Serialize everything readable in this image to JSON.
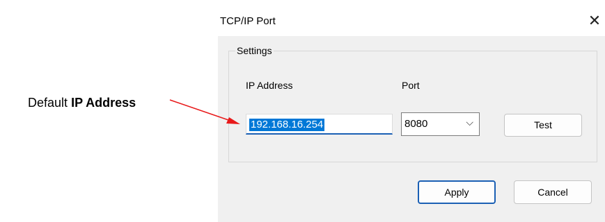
{
  "annotation": {
    "prefix": "Default",
    "bold": "IP Address"
  },
  "dialog": {
    "title": "TCP/IP Port",
    "close_icon": "close-icon",
    "settings_group": {
      "legend": "Settings",
      "ip_label": "IP Address",
      "ip_value": "192.168.16.254",
      "port_label": "Port",
      "port_value": "8080",
      "port_dropdown_icon": "chevron-down-icon",
      "test_label": "Test"
    },
    "apply_label": "Apply",
    "cancel_label": "Cancel"
  },
  "colors": {
    "selection": "#0078d7",
    "arrow": "#e8191a",
    "accent": "#1a5fb4"
  }
}
